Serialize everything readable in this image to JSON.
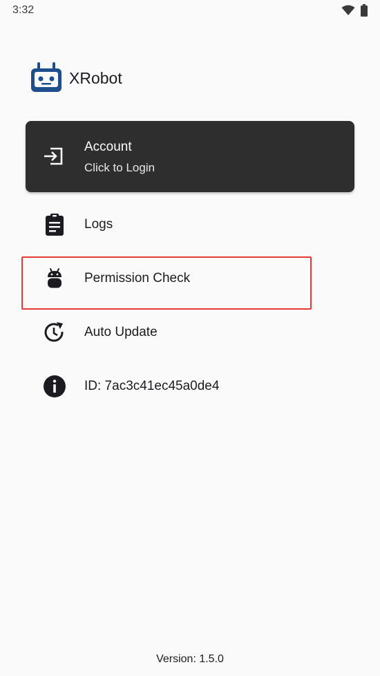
{
  "status_bar": {
    "time": "3:32",
    "icons": [
      "wifi-icon",
      "battery-icon"
    ]
  },
  "app": {
    "name": "XRobot",
    "logo_icon": "robot-logo-icon",
    "brand_color": "#1f4e8c"
  },
  "account": {
    "title": "Account",
    "subtitle": "Click to Login",
    "icon": "login-icon"
  },
  "menu": [
    {
      "label": "Logs",
      "icon": "clipboard-icon"
    },
    {
      "label": "Permission Check",
      "icon": "android-icon"
    },
    {
      "label": "Auto Update",
      "icon": "update-icon"
    },
    {
      "label": "ID: 7ac3c41ec45a0de4",
      "icon": "info-icon"
    }
  ],
  "highlight_color": "#e53935",
  "footer": {
    "version": "Version: 1.5.0"
  }
}
